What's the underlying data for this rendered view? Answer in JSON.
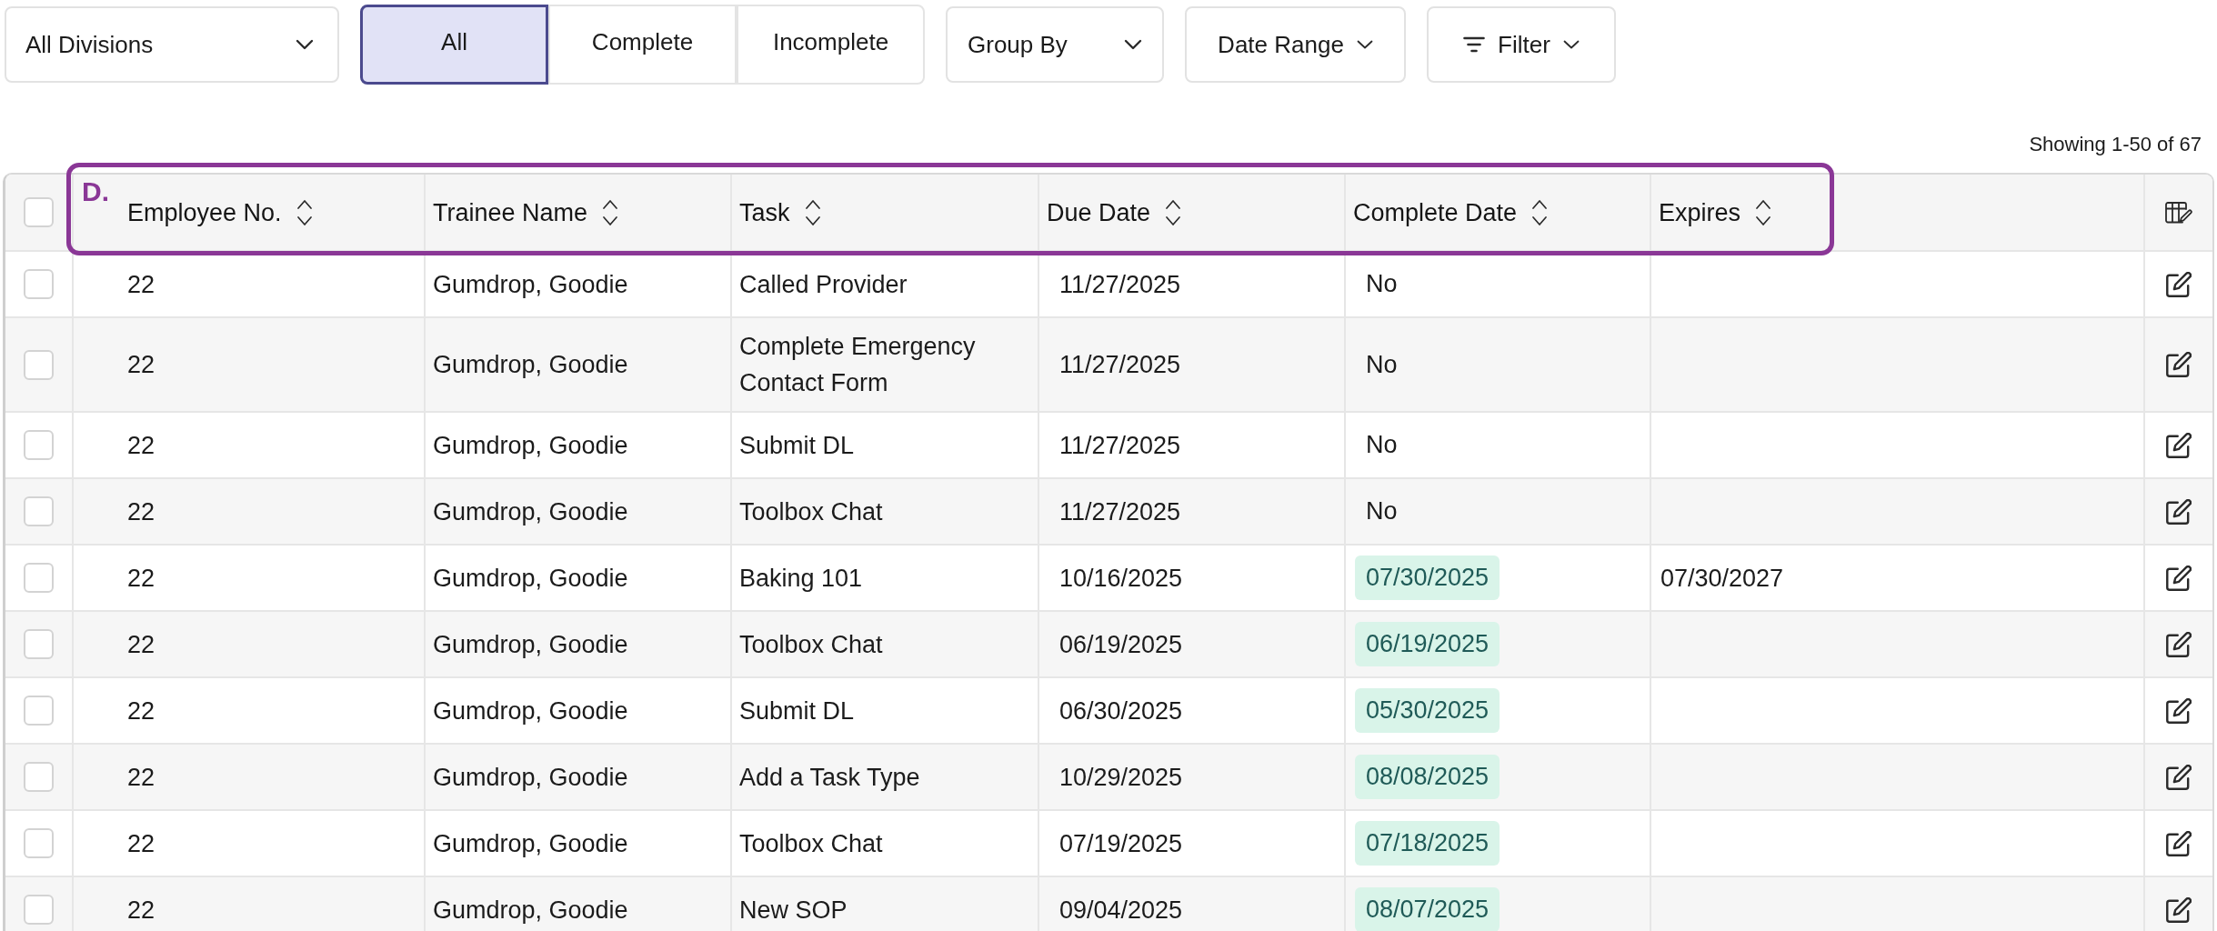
{
  "toolbar": {
    "division_select": {
      "value": "All Divisions"
    },
    "status_filter": [
      {
        "label": "All",
        "selected": true
      },
      {
        "label": "Complete",
        "selected": false
      },
      {
        "label": "Incomplete",
        "selected": false
      }
    ],
    "group_by": {
      "label": "Group By"
    },
    "date_range": {
      "label": "Date Range"
    },
    "filter": {
      "label": "Filter"
    }
  },
  "summary": "Showing 1-50 of 67",
  "table": {
    "select_all_checked": false,
    "columns": [
      {
        "label": "Employee No."
      },
      {
        "label": "Trainee Name"
      },
      {
        "label": "Task"
      },
      {
        "label": "Due Date"
      },
      {
        "label": "Complete Date"
      },
      {
        "label": "Expires"
      }
    ],
    "rows": [
      {
        "checked": false,
        "employee_no": "22",
        "trainee_name": "Gumdrop, Goodie",
        "task": "Called Provider",
        "due_date": "11/27/2025",
        "complete_date": "No",
        "completed": false
      },
      {
        "checked": false,
        "employee_no": "22",
        "trainee_name": "Gumdrop, Goodie",
        "task": "Complete Emergency Contact Form",
        "due_date": "11/27/2025",
        "complete_date": "No",
        "completed": false
      },
      {
        "checked": false,
        "employee_no": "22",
        "trainee_name": "Gumdrop, Goodie",
        "task": "Submit DL",
        "due_date": "11/27/2025",
        "complete_date": "No",
        "completed": false
      },
      {
        "checked": false,
        "employee_no": "22",
        "trainee_name": "Gumdrop, Goodie",
        "task": "Toolbox Chat",
        "due_date": "11/27/2025",
        "complete_date": "No",
        "completed": false
      },
      {
        "checked": false,
        "employee_no": "22",
        "trainee_name": "Gumdrop, Goodie",
        "task": "Baking 101",
        "due_date": "10/16/2025",
        "complete_date": "07/30/2025",
        "completed": true,
        "expires": "07/30/2027"
      },
      {
        "checked": false,
        "employee_no": "22",
        "trainee_name": "Gumdrop, Goodie",
        "task": "Toolbox Chat",
        "due_date": "06/19/2025",
        "complete_date": "06/19/2025",
        "completed": true
      },
      {
        "checked": false,
        "employee_no": "22",
        "trainee_name": "Gumdrop, Goodie",
        "task": "Submit DL",
        "due_date": "06/30/2025",
        "complete_date": "05/30/2025",
        "completed": true
      },
      {
        "checked": false,
        "employee_no": "22",
        "trainee_name": "Gumdrop, Goodie",
        "task": "Add a Task Type",
        "due_date": "10/29/2025",
        "complete_date": "08/08/2025",
        "completed": true
      },
      {
        "checked": false,
        "employee_no": "22",
        "trainee_name": "Gumdrop, Goodie",
        "task": "Toolbox Chat",
        "due_date": "07/19/2025",
        "complete_date": "07/18/2025",
        "completed": true
      },
      {
        "checked": false,
        "employee_no": "22",
        "trainee_name": "Gumdrop, Goodie",
        "task": "New SOP",
        "due_date": "09/04/2025",
        "complete_date": "08/07/2025",
        "completed": true
      }
    ]
  },
  "annotation": {
    "label": "D."
  }
}
